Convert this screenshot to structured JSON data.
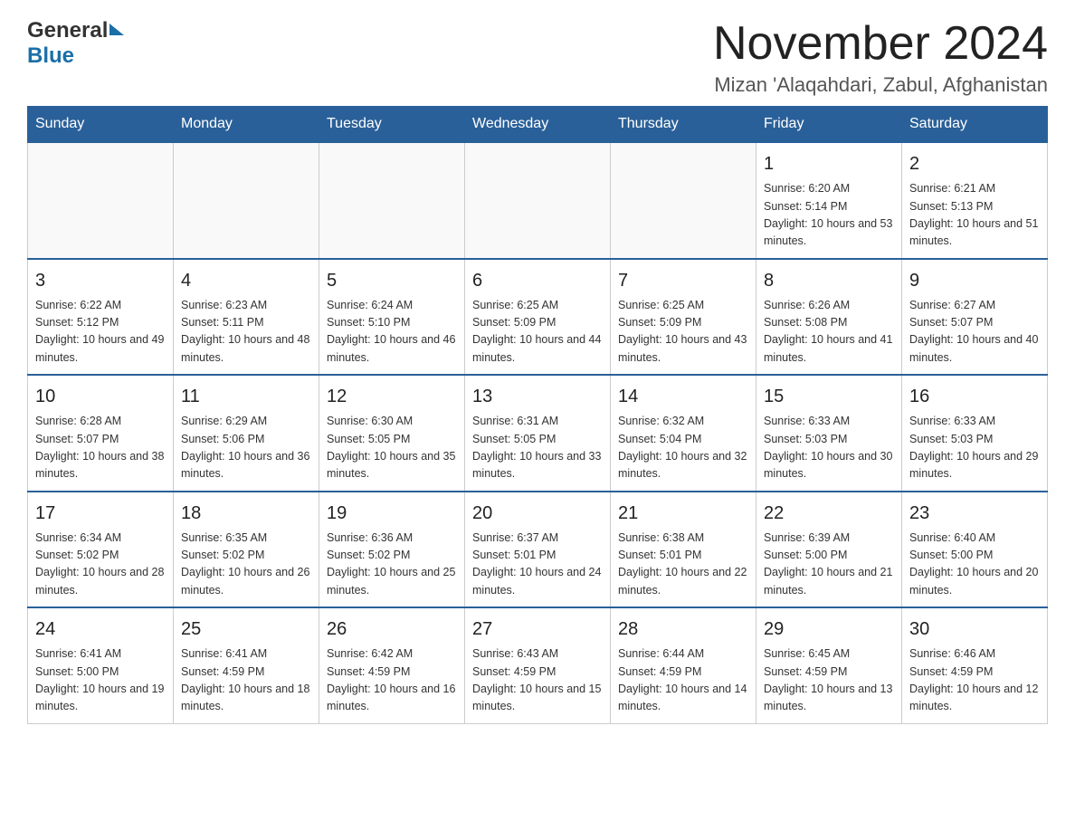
{
  "header": {
    "logo_general": "General",
    "logo_blue": "Blue",
    "month_title": "November 2024",
    "location": "Mizan 'Alaqahdari, Zabul, Afghanistan"
  },
  "weekdays": [
    "Sunday",
    "Monday",
    "Tuesday",
    "Wednesday",
    "Thursday",
    "Friday",
    "Saturday"
  ],
  "weeks": [
    [
      {
        "day": "",
        "info": ""
      },
      {
        "day": "",
        "info": ""
      },
      {
        "day": "",
        "info": ""
      },
      {
        "day": "",
        "info": ""
      },
      {
        "day": "",
        "info": ""
      },
      {
        "day": "1",
        "info": "Sunrise: 6:20 AM\nSunset: 5:14 PM\nDaylight: 10 hours and 53 minutes."
      },
      {
        "day": "2",
        "info": "Sunrise: 6:21 AM\nSunset: 5:13 PM\nDaylight: 10 hours and 51 minutes."
      }
    ],
    [
      {
        "day": "3",
        "info": "Sunrise: 6:22 AM\nSunset: 5:12 PM\nDaylight: 10 hours and 49 minutes."
      },
      {
        "day": "4",
        "info": "Sunrise: 6:23 AM\nSunset: 5:11 PM\nDaylight: 10 hours and 48 minutes."
      },
      {
        "day": "5",
        "info": "Sunrise: 6:24 AM\nSunset: 5:10 PM\nDaylight: 10 hours and 46 minutes."
      },
      {
        "day": "6",
        "info": "Sunrise: 6:25 AM\nSunset: 5:09 PM\nDaylight: 10 hours and 44 minutes."
      },
      {
        "day": "7",
        "info": "Sunrise: 6:25 AM\nSunset: 5:09 PM\nDaylight: 10 hours and 43 minutes."
      },
      {
        "day": "8",
        "info": "Sunrise: 6:26 AM\nSunset: 5:08 PM\nDaylight: 10 hours and 41 minutes."
      },
      {
        "day": "9",
        "info": "Sunrise: 6:27 AM\nSunset: 5:07 PM\nDaylight: 10 hours and 40 minutes."
      }
    ],
    [
      {
        "day": "10",
        "info": "Sunrise: 6:28 AM\nSunset: 5:07 PM\nDaylight: 10 hours and 38 minutes."
      },
      {
        "day": "11",
        "info": "Sunrise: 6:29 AM\nSunset: 5:06 PM\nDaylight: 10 hours and 36 minutes."
      },
      {
        "day": "12",
        "info": "Sunrise: 6:30 AM\nSunset: 5:05 PM\nDaylight: 10 hours and 35 minutes."
      },
      {
        "day": "13",
        "info": "Sunrise: 6:31 AM\nSunset: 5:05 PM\nDaylight: 10 hours and 33 minutes."
      },
      {
        "day": "14",
        "info": "Sunrise: 6:32 AM\nSunset: 5:04 PM\nDaylight: 10 hours and 32 minutes."
      },
      {
        "day": "15",
        "info": "Sunrise: 6:33 AM\nSunset: 5:03 PM\nDaylight: 10 hours and 30 minutes."
      },
      {
        "day": "16",
        "info": "Sunrise: 6:33 AM\nSunset: 5:03 PM\nDaylight: 10 hours and 29 minutes."
      }
    ],
    [
      {
        "day": "17",
        "info": "Sunrise: 6:34 AM\nSunset: 5:02 PM\nDaylight: 10 hours and 28 minutes."
      },
      {
        "day": "18",
        "info": "Sunrise: 6:35 AM\nSunset: 5:02 PM\nDaylight: 10 hours and 26 minutes."
      },
      {
        "day": "19",
        "info": "Sunrise: 6:36 AM\nSunset: 5:02 PM\nDaylight: 10 hours and 25 minutes."
      },
      {
        "day": "20",
        "info": "Sunrise: 6:37 AM\nSunset: 5:01 PM\nDaylight: 10 hours and 24 minutes."
      },
      {
        "day": "21",
        "info": "Sunrise: 6:38 AM\nSunset: 5:01 PM\nDaylight: 10 hours and 22 minutes."
      },
      {
        "day": "22",
        "info": "Sunrise: 6:39 AM\nSunset: 5:00 PM\nDaylight: 10 hours and 21 minutes."
      },
      {
        "day": "23",
        "info": "Sunrise: 6:40 AM\nSunset: 5:00 PM\nDaylight: 10 hours and 20 minutes."
      }
    ],
    [
      {
        "day": "24",
        "info": "Sunrise: 6:41 AM\nSunset: 5:00 PM\nDaylight: 10 hours and 19 minutes."
      },
      {
        "day": "25",
        "info": "Sunrise: 6:41 AM\nSunset: 4:59 PM\nDaylight: 10 hours and 18 minutes."
      },
      {
        "day": "26",
        "info": "Sunrise: 6:42 AM\nSunset: 4:59 PM\nDaylight: 10 hours and 16 minutes."
      },
      {
        "day": "27",
        "info": "Sunrise: 6:43 AM\nSunset: 4:59 PM\nDaylight: 10 hours and 15 minutes."
      },
      {
        "day": "28",
        "info": "Sunrise: 6:44 AM\nSunset: 4:59 PM\nDaylight: 10 hours and 14 minutes."
      },
      {
        "day": "29",
        "info": "Sunrise: 6:45 AM\nSunset: 4:59 PM\nDaylight: 10 hours and 13 minutes."
      },
      {
        "day": "30",
        "info": "Sunrise: 6:46 AM\nSunset: 4:59 PM\nDaylight: 10 hours and 12 minutes."
      }
    ]
  ]
}
